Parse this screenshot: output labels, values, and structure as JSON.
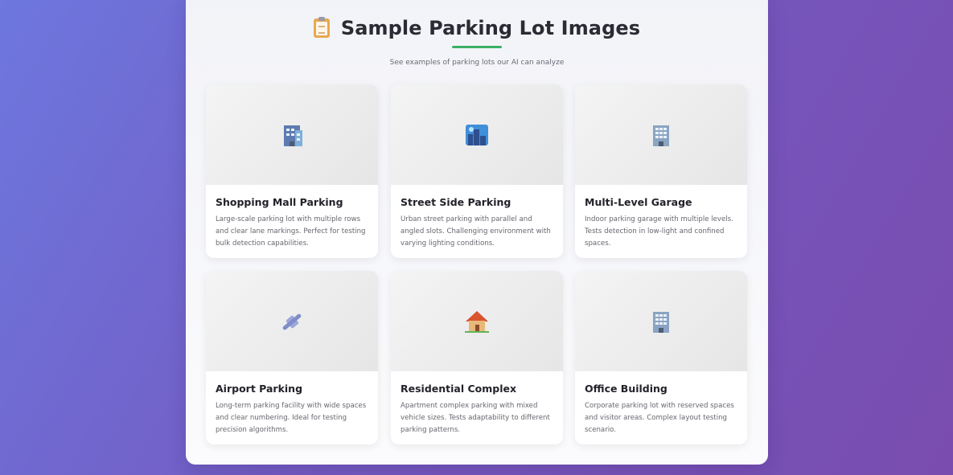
{
  "page": {
    "title_icon": "clipboard-icon",
    "title": "Sample Parking Lot Images",
    "subtitle": "See examples of parking lots our AI can analyze",
    "accent_color": "#3bb067"
  },
  "cards": [
    {
      "icon": "department-store-icon",
      "title": "Shopping Mall Parking",
      "description": "Large-scale parking lot with multiple rows and clear lane markings. Perfect for testing bulk detection capabilities."
    },
    {
      "icon": "cityscape-icon",
      "title": "Street Side Parking",
      "description": "Urban street parking with parallel and angled slots. Challenging environment with varying lighting conditions."
    },
    {
      "icon": "office-building-icon",
      "title": "Multi-Level Garage",
      "description": "Indoor parking garage with multiple levels. Tests detection in low-light and confined spaces."
    },
    {
      "icon": "airplane-icon",
      "title": "Airport Parking",
      "description": "Long-term parking facility with wide spaces and clear numbering. Ideal for testing precision algorithms."
    },
    {
      "icon": "house-icon",
      "title": "Residential Complex",
      "description": "Apartment complex parking with mixed vehicle sizes. Tests adaptability to different parking patterns."
    },
    {
      "icon": "office-building-icon",
      "title": "Office Building",
      "description": "Corporate parking lot with reserved spaces and visitor areas. Complex layout testing scenario."
    }
  ]
}
